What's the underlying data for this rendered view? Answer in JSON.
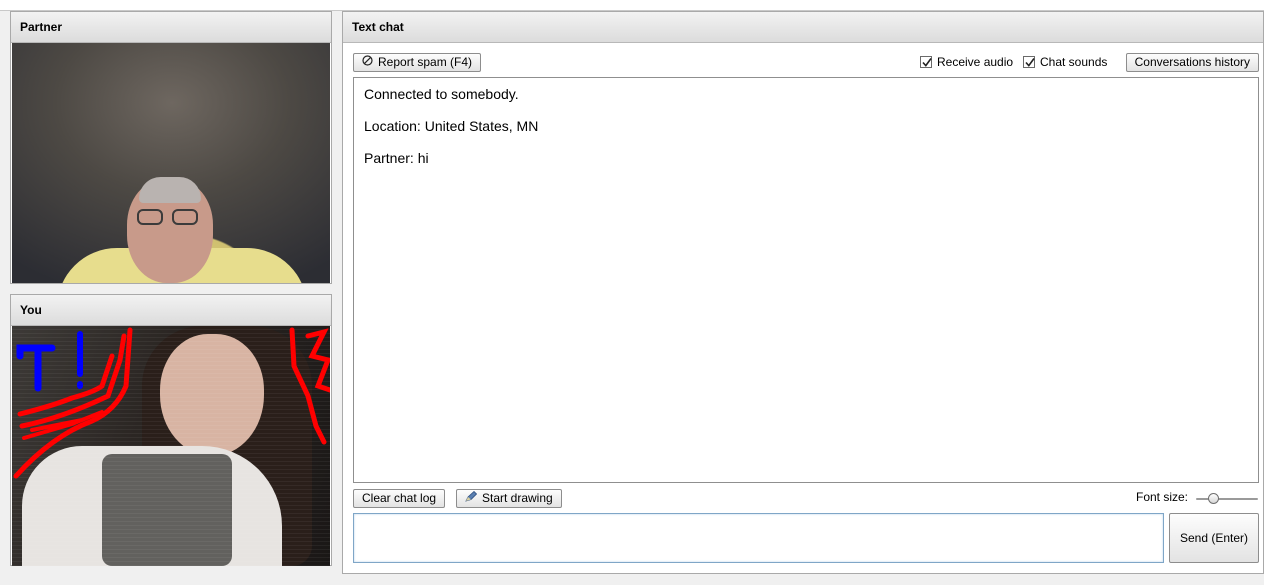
{
  "partner_panel": {
    "title": "Partner"
  },
  "you_panel": {
    "title": "You"
  },
  "chat_panel": {
    "title": "Text chat",
    "report_spam_label": "Report spam (F4)",
    "receive_audio": {
      "label": "Receive audio",
      "checked": true
    },
    "chat_sounds": {
      "label": "Chat sounds",
      "checked": true
    },
    "conversations_history_label": "Conversations history",
    "messages": [
      "Connected to somebody.",
      "Location: United States, MN",
      "Partner: hi"
    ],
    "clear_chat_log_label": "Clear chat log",
    "start_drawing_label": "Start drawing",
    "font_size_label": "Font size:",
    "font_size_value": 0.25,
    "message_input_value": "",
    "send_label": "Send (Enter)"
  },
  "colors": {
    "drawing_red": "#ff0000",
    "drawing_blue": "#0000ff",
    "input_border": "#7fa6c7"
  }
}
